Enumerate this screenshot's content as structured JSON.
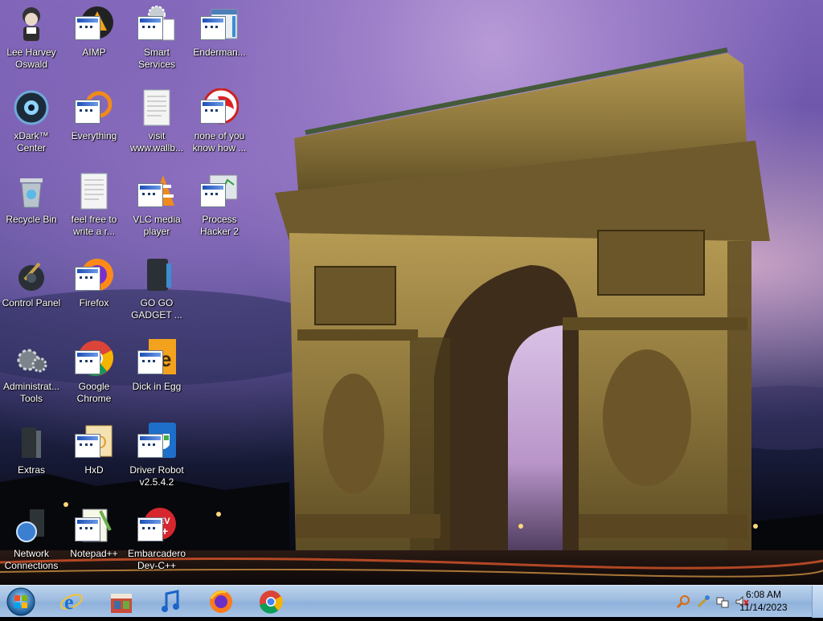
{
  "desktop": {
    "icons": [
      {
        "id": "lee-harvey-oswald",
        "label": "Lee Harvey\nOswald"
      },
      {
        "id": "aimp",
        "label": "AIMP"
      },
      {
        "id": "smart-services",
        "label": "Smart\nServices"
      },
      {
        "id": "enderman",
        "label": "Enderman..."
      },
      {
        "id": "xdark-center",
        "label": "xDark™\nCenter"
      },
      {
        "id": "everything",
        "label": "Everything"
      },
      {
        "id": "visit-wallb",
        "label": "visit\nwww.wallb..."
      },
      {
        "id": "none-of-you",
        "label": "none of you\nknow how ..."
      },
      {
        "id": "recycle-bin",
        "label": "Recycle Bin"
      },
      {
        "id": "feel-free",
        "label": "feel free to\nwrite a r..."
      },
      {
        "id": "vlc",
        "label": "VLC media\nplayer"
      },
      {
        "id": "process-hacker",
        "label": "Process\nHacker 2"
      },
      {
        "id": "control-panel",
        "label": "Control Panel"
      },
      {
        "id": "firefox",
        "label": "Firefox"
      },
      {
        "id": "go-go-gadget",
        "label": "GO GO\nGADGET ..."
      },
      {
        "id": "admin-tools",
        "label": "Administrat...\nTools"
      },
      {
        "id": "google-chrome",
        "label": "Google\nChrome"
      },
      {
        "id": "dick-in-egg",
        "label": "Dick in Egg"
      },
      {
        "id": "extras",
        "label": "Extras"
      },
      {
        "id": "hxd",
        "label": "HxD"
      },
      {
        "id": "driver-robot",
        "label": "Driver Robot\nv2.5.4.2"
      },
      {
        "id": "network-connections",
        "label": "Network\nConnections"
      },
      {
        "id": "notepadpp",
        "label": "Notepad++"
      },
      {
        "id": "embarcadero",
        "label": "Embarcadero\nDev-C++"
      }
    ]
  },
  "taskbar": {
    "pinned": [
      "internet-explorer-icon",
      "store-icon",
      "music-icon",
      "firefox-icon",
      "chrome-icon"
    ],
    "clock_time": "6:08 AM",
    "clock_date": "11/14/2023"
  },
  "colors": {
    "taskbar": "#9ebce0",
    "accent": "#1d4fb6"
  }
}
